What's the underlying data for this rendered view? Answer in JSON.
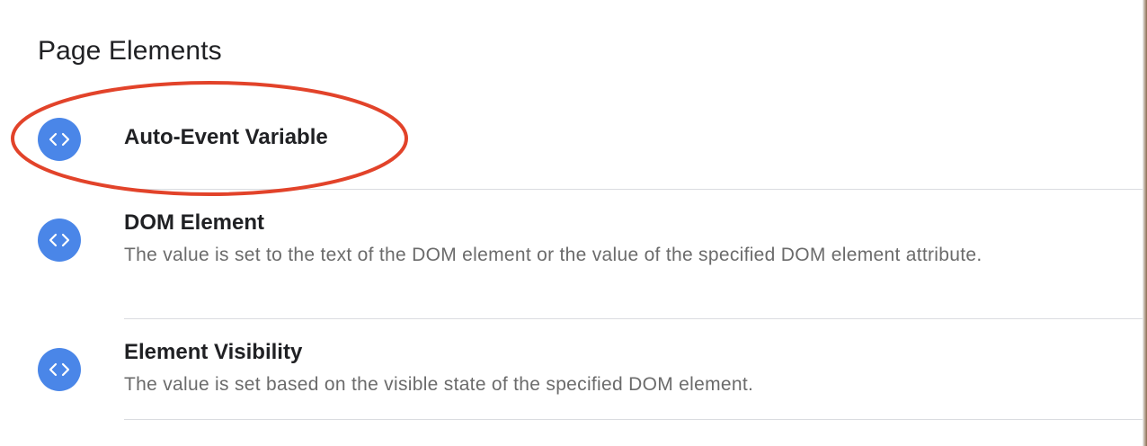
{
  "section": {
    "title": "Page Elements"
  },
  "items": [
    {
      "title": "Auto-Event Variable",
      "description": "",
      "icon": "code-brackets-icon"
    },
    {
      "title": "DOM Element",
      "description": "The value is set to the text of the DOM element or the value of the specified DOM element attribute.",
      "icon": "code-brackets-icon"
    },
    {
      "title": "Element Visibility",
      "description": "The value is set based on the visible state of the specified DOM element.",
      "icon": "code-brackets-icon"
    }
  ],
  "colors": {
    "icon_background": "#4a86e8",
    "highlight_annotation": "#e2432a",
    "divider": "#dadce0",
    "description_text": "#6b6b6b"
  }
}
